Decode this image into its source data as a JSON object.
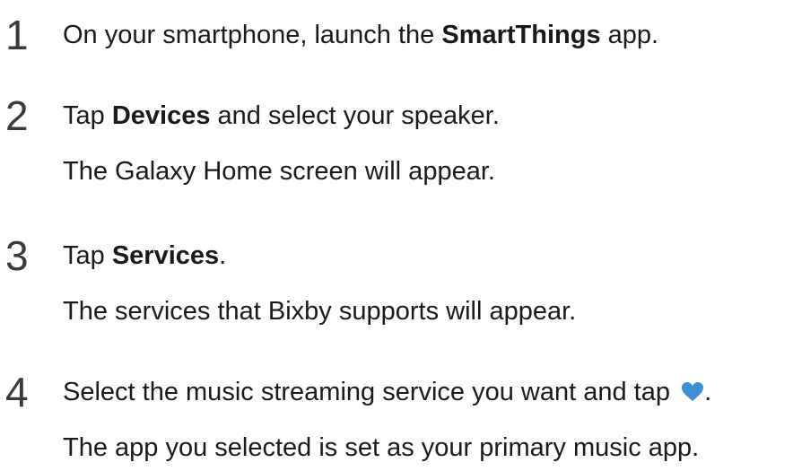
{
  "steps": [
    {
      "number": "1",
      "before": "On your smartphone, launch the ",
      "bold": "SmartThings",
      "after": " app.",
      "note": ""
    },
    {
      "number": "2",
      "before": "Tap ",
      "bold": "Devices",
      "after": " and select your speaker.",
      "note": "The Galaxy Home screen will appear."
    },
    {
      "number": "3",
      "before": "Tap ",
      "bold": "Services",
      "after": ".",
      "note": "The services that Bixby supports will appear."
    },
    {
      "number": "4",
      "before": "Select the music streaming service you want and tap ",
      "bold": "",
      "after": ".",
      "icon": "heart-icon",
      "note": "The app you selected is set as your primary music app."
    }
  ],
  "colors": {
    "heart": "#3d8fd6",
    "text": "#1a1a1a",
    "number": "#3a3a3a"
  }
}
